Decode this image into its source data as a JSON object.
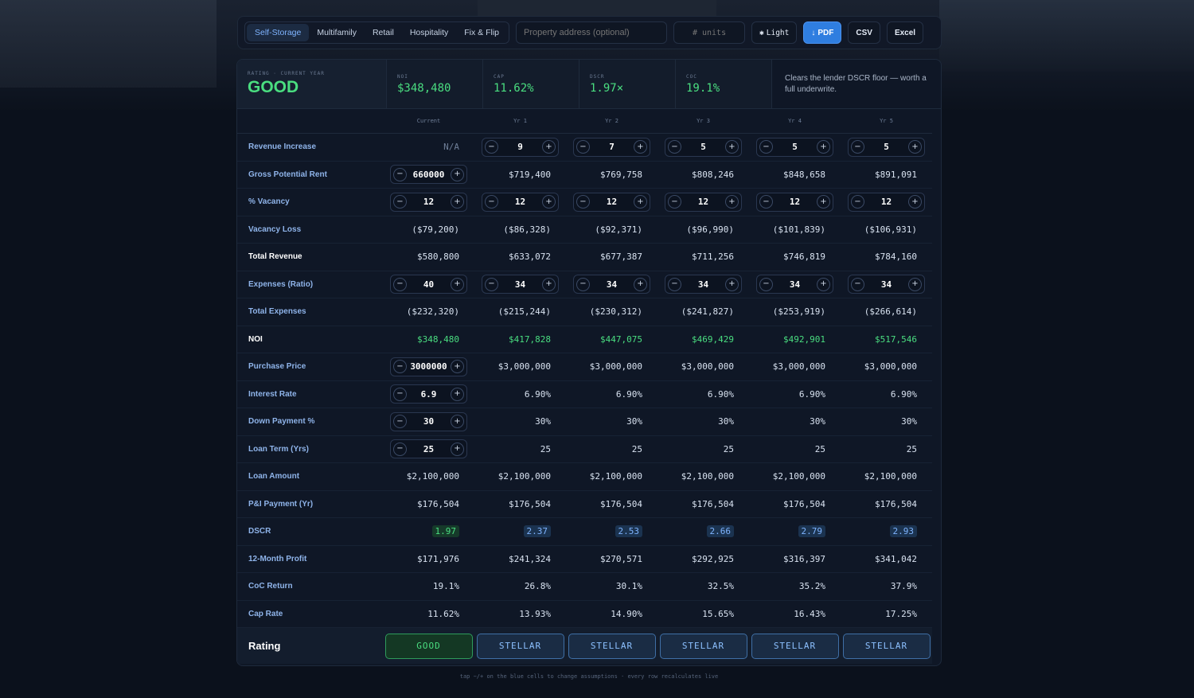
{
  "tabs": [
    {
      "label": "Self-Storage",
      "active": true
    },
    {
      "label": "Multifamily",
      "active": false
    },
    {
      "label": "Retail",
      "active": false
    },
    {
      "label": "Hospitality",
      "active": false
    },
    {
      "label": "Fix & Flip",
      "active": false
    }
  ],
  "address": {
    "placeholder": "Property address (optional)",
    "value": ""
  },
  "units": {
    "placeholder": "# units",
    "value": ""
  },
  "toolbar": {
    "theme_label": "Light",
    "pdf_label": "PDF",
    "csv_label": "CSV",
    "excel_label": "Excel"
  },
  "summary": {
    "rating_label": "Rating · current year",
    "rating": "GOOD",
    "metrics": [
      {
        "label": "NOI",
        "value": "$348,480"
      },
      {
        "label": "Cap",
        "value": "11.62%"
      },
      {
        "label": "DSCR",
        "value": "1.97×"
      },
      {
        "label": "CoC",
        "value": "19.1%"
      }
    ],
    "note": "Clears the lender DSCR floor — worth a full underwrite."
  },
  "columns": [
    "Current",
    "Yr 1",
    "Yr 2",
    "Yr 3",
    "Yr 4",
    "Yr 5"
  ],
  "rows": [
    {
      "label": "Revenue Increase",
      "cells": [
        {
          "t": "na",
          "v": "N/A"
        },
        {
          "t": "step",
          "v": "9"
        },
        {
          "t": "step",
          "v": "7"
        },
        {
          "t": "step",
          "v": "5"
        },
        {
          "t": "step",
          "v": "5"
        },
        {
          "t": "step",
          "v": "5"
        }
      ]
    },
    {
      "label": "Gross Potential Rent",
      "cells": [
        {
          "t": "step",
          "v": "660000"
        },
        {
          "t": "v",
          "v": "$719,400"
        },
        {
          "t": "v",
          "v": "$769,758"
        },
        {
          "t": "v",
          "v": "$808,246"
        },
        {
          "t": "v",
          "v": "$848,658"
        },
        {
          "t": "v",
          "v": "$891,091"
        }
      ]
    },
    {
      "label": "% Vacancy",
      "cells": [
        {
          "t": "step",
          "v": "12"
        },
        {
          "t": "step",
          "v": "12"
        },
        {
          "t": "step",
          "v": "12"
        },
        {
          "t": "step",
          "v": "12"
        },
        {
          "t": "step",
          "v": "12"
        },
        {
          "t": "step",
          "v": "12"
        }
      ]
    },
    {
      "label": "Vacancy Loss",
      "cells": [
        {
          "t": "v",
          "v": "($79,200)"
        },
        {
          "t": "v",
          "v": "($86,328)"
        },
        {
          "t": "v",
          "v": "($92,371)"
        },
        {
          "t": "v",
          "v": "($96,990)"
        },
        {
          "t": "v",
          "v": "($101,839)"
        },
        {
          "t": "v",
          "v": "($106,931)"
        }
      ]
    },
    {
      "label": "Total Revenue",
      "white": true,
      "cells": [
        {
          "t": "v",
          "v": "$580,800"
        },
        {
          "t": "v",
          "v": "$633,072"
        },
        {
          "t": "v",
          "v": "$677,387"
        },
        {
          "t": "v",
          "v": "$711,256"
        },
        {
          "t": "v",
          "v": "$746,819"
        },
        {
          "t": "v",
          "v": "$784,160"
        }
      ]
    },
    {
      "label": "Expenses (Ratio)",
      "cells": [
        {
          "t": "step",
          "v": "40"
        },
        {
          "t": "step",
          "v": "34"
        },
        {
          "t": "step",
          "v": "34"
        },
        {
          "t": "step",
          "v": "34"
        },
        {
          "t": "step",
          "v": "34"
        },
        {
          "t": "step",
          "v": "34"
        }
      ]
    },
    {
      "label": "Total Expenses",
      "cells": [
        {
          "t": "v",
          "v": "($232,320)"
        },
        {
          "t": "v",
          "v": "($215,244)"
        },
        {
          "t": "v",
          "v": "($230,312)"
        },
        {
          "t": "v",
          "v": "($241,827)"
        },
        {
          "t": "v",
          "v": "($253,919)"
        },
        {
          "t": "v",
          "v": "($266,614)"
        }
      ]
    },
    {
      "label": "NOI",
      "white": true,
      "cells": [
        {
          "t": "g",
          "v": "$348,480"
        },
        {
          "t": "g",
          "v": "$417,828"
        },
        {
          "t": "g",
          "v": "$447,075"
        },
        {
          "t": "g",
          "v": "$469,429"
        },
        {
          "t": "g",
          "v": "$492,901"
        },
        {
          "t": "g",
          "v": "$517,546"
        }
      ]
    },
    {
      "label": "Purchase Price",
      "cells": [
        {
          "t": "step",
          "v": "3000000"
        },
        {
          "t": "v",
          "v": "$3,000,000"
        },
        {
          "t": "v",
          "v": "$3,000,000"
        },
        {
          "t": "v",
          "v": "$3,000,000"
        },
        {
          "t": "v",
          "v": "$3,000,000"
        },
        {
          "t": "v",
          "v": "$3,000,000"
        }
      ]
    },
    {
      "label": "Interest Rate",
      "cells": [
        {
          "t": "step",
          "v": "6.9"
        },
        {
          "t": "v",
          "v": "6.90%"
        },
        {
          "t": "v",
          "v": "6.90%"
        },
        {
          "t": "v",
          "v": "6.90%"
        },
        {
          "t": "v",
          "v": "6.90%"
        },
        {
          "t": "v",
          "v": "6.90%"
        }
      ]
    },
    {
      "label": "Down Payment %",
      "cells": [
        {
          "t": "step",
          "v": "30"
        },
        {
          "t": "v",
          "v": "30%"
        },
        {
          "t": "v",
          "v": "30%"
        },
        {
          "t": "v",
          "v": "30%"
        },
        {
          "t": "v",
          "v": "30%"
        },
        {
          "t": "v",
          "v": "30%"
        }
      ]
    },
    {
      "label": "Loan Term (Yrs)",
      "cells": [
        {
          "t": "step",
          "v": "25"
        },
        {
          "t": "v",
          "v": "25"
        },
        {
          "t": "v",
          "v": "25"
        },
        {
          "t": "v",
          "v": "25"
        },
        {
          "t": "v",
          "v": "25"
        },
        {
          "t": "v",
          "v": "25"
        }
      ]
    },
    {
      "label": "Loan Amount",
      "cells": [
        {
          "t": "v",
          "v": "$2,100,000"
        },
        {
          "t": "v",
          "v": "$2,100,000"
        },
        {
          "t": "v",
          "v": "$2,100,000"
        },
        {
          "t": "v",
          "v": "$2,100,000"
        },
        {
          "t": "v",
          "v": "$2,100,000"
        },
        {
          "t": "v",
          "v": "$2,100,000"
        }
      ]
    },
    {
      "label": "P&I Payment (Yr)",
      "cells": [
        {
          "t": "v",
          "v": "$176,504"
        },
        {
          "t": "v",
          "v": "$176,504"
        },
        {
          "t": "v",
          "v": "$176,504"
        },
        {
          "t": "v",
          "v": "$176,504"
        },
        {
          "t": "v",
          "v": "$176,504"
        },
        {
          "t": "v",
          "v": "$176,504"
        }
      ]
    },
    {
      "label": "DSCR",
      "cells": [
        {
          "t": "badge-good",
          "v": "1.97"
        },
        {
          "t": "badge",
          "v": "2.37"
        },
        {
          "t": "badge",
          "v": "2.53"
        },
        {
          "t": "badge",
          "v": "2.66"
        },
        {
          "t": "badge",
          "v": "2.79"
        },
        {
          "t": "badge",
          "v": "2.93"
        }
      ]
    },
    {
      "label": "12-Month Profit",
      "cells": [
        {
          "t": "v",
          "v": "$171,976"
        },
        {
          "t": "v",
          "v": "$241,324"
        },
        {
          "t": "v",
          "v": "$270,571"
        },
        {
          "t": "v",
          "v": "$292,925"
        },
        {
          "t": "v",
          "v": "$316,397"
        },
        {
          "t": "v",
          "v": "$341,042"
        }
      ]
    },
    {
      "label": "CoC Return",
      "cells": [
        {
          "t": "v",
          "v": "19.1%"
        },
        {
          "t": "v",
          "v": "26.8%"
        },
        {
          "t": "v",
          "v": "30.1%"
        },
        {
          "t": "v",
          "v": "32.5%"
        },
        {
          "t": "v",
          "v": "35.2%"
        },
        {
          "t": "v",
          "v": "37.9%"
        }
      ]
    },
    {
      "label": "Cap Rate",
      "cells": [
        {
          "t": "v",
          "v": "11.62%"
        },
        {
          "t": "v",
          "v": "13.93%"
        },
        {
          "t": "v",
          "v": "14.90%"
        },
        {
          "t": "v",
          "v": "15.65%"
        },
        {
          "t": "v",
          "v": "16.43%"
        },
        {
          "t": "v",
          "v": "17.25%"
        }
      ]
    }
  ],
  "rating_row": {
    "label": "Rating",
    "values": [
      "GOOD",
      "STELLAR",
      "STELLAR",
      "STELLAR",
      "STELLAR",
      "STELLAR"
    ]
  },
  "footer": "tap −/+ on the blue cells to change assumptions · every row recalculates live",
  "colors": {
    "accent": "#2f7ee0",
    "good": "#4ade80",
    "stellar": "#8cc0ff",
    "background": "#0b111c"
  }
}
